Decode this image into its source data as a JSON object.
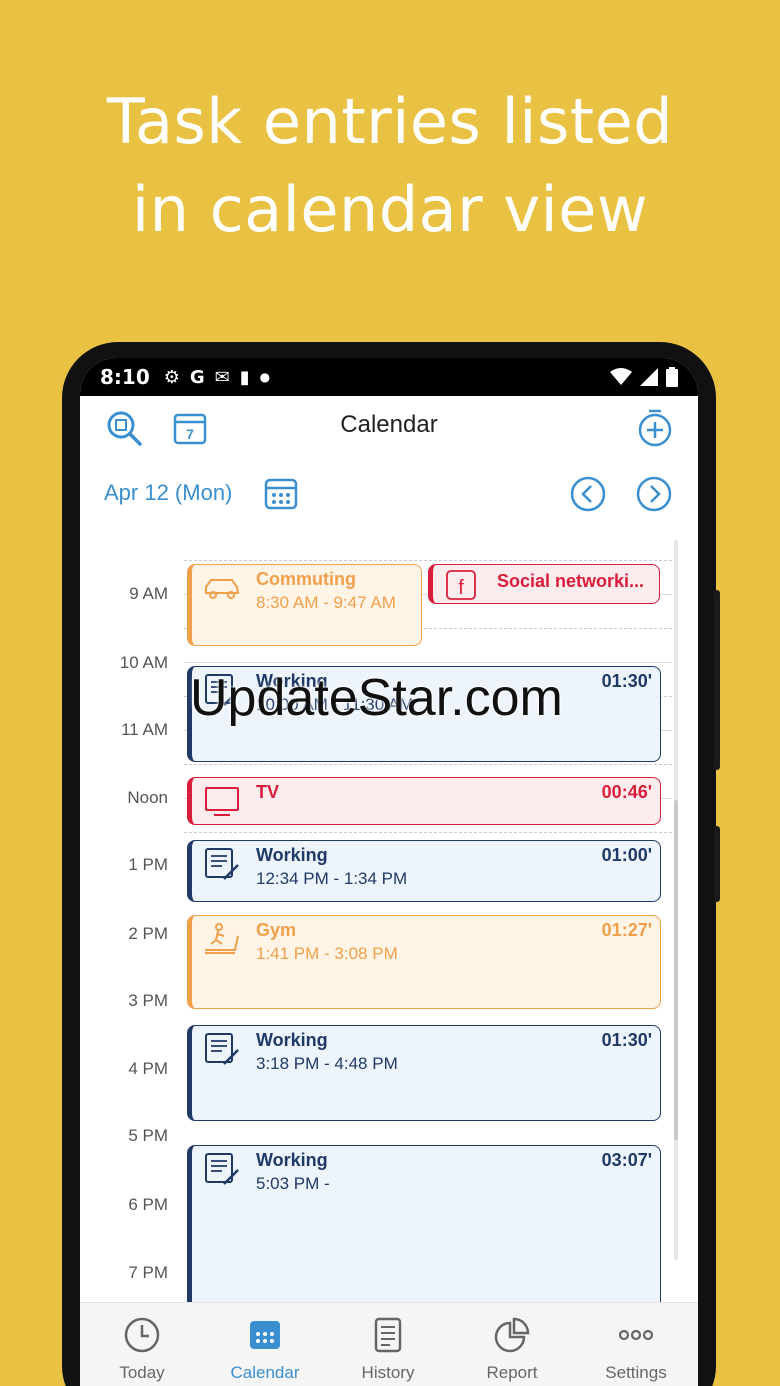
{
  "headline": {
    "line1": "Task entries listed",
    "line2": "in calendar view"
  },
  "status": {
    "time": "8:10",
    "icons": [
      "settings-icon",
      "google-icon",
      "gmail-icon",
      "sd-card-icon",
      "dot-icon"
    ],
    "right_icons": [
      "wifi-icon",
      "signal-icon",
      "battery-icon"
    ]
  },
  "appbar": {
    "title": "Calendar"
  },
  "datebar": {
    "date": "Apr 12 (Mon)"
  },
  "hours": [
    "9 AM",
    "10 AM",
    "11 AM",
    "Noon",
    "1 PM",
    "2 PM",
    "3 PM",
    "4 PM",
    "5 PM",
    "6 PM",
    "7 PM"
  ],
  "events": [
    {
      "title": "Commuting",
      "time": "8:30 AM - 9:47 AM",
      "duration": "",
      "color": "#F0A04B",
      "icon": "car-icon"
    },
    {
      "title": "Social networki...",
      "time": "",
      "duration": "",
      "color": "#D81E3A",
      "icon": "facebook-icon"
    },
    {
      "title": "Working",
      "time": "10:00 AM - 11:30 AM",
      "duration": "01:30'",
      "color": "#1F3A66",
      "icon": "document-edit-icon"
    },
    {
      "title": "TV",
      "time": "",
      "duration": "00:46'",
      "color": "#D81E3A",
      "icon": "tv-icon"
    },
    {
      "title": "Working",
      "time": "12:34 PM - 1:34 PM",
      "duration": "01:00'",
      "color": "#1F3A66",
      "icon": "document-edit-icon"
    },
    {
      "title": "Gym",
      "time": "1:41 PM - 3:08 PM",
      "duration": "01:27'",
      "color": "#F0A04B",
      "icon": "treadmill-icon"
    },
    {
      "title": "Working",
      "time": "3:18 PM - 4:48 PM",
      "duration": "01:30'",
      "color": "#1F3A66",
      "icon": "document-edit-icon"
    },
    {
      "title": "Working",
      "time": "5:03 PM -",
      "duration": "03:07'",
      "color": "#1F3A66",
      "icon": "document-edit-icon"
    }
  ],
  "watermark": "UpdateStar.com",
  "nav": [
    {
      "label": "Today",
      "icon": "clock-icon"
    },
    {
      "label": "Calendar",
      "icon": "calendar-icon"
    },
    {
      "label": "History",
      "icon": "history-list-icon"
    },
    {
      "label": "Report",
      "icon": "pie-chart-icon"
    },
    {
      "label": "Settings",
      "icon": "more-dots-icon"
    }
  ],
  "colors": {
    "background": "#E9C244",
    "accent": "#3A8FD0",
    "work": "#1F3A66",
    "leisure": "#F0A04B",
    "media": "#D81E3A"
  }
}
